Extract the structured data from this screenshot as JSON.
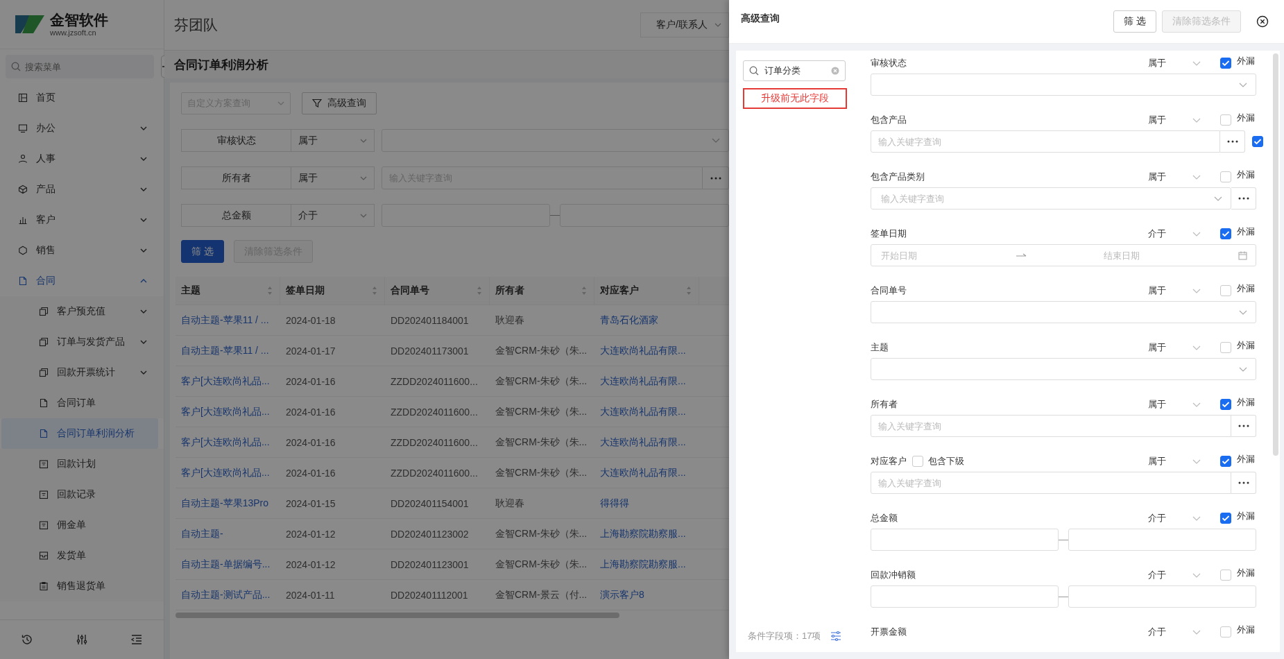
{
  "brand": {
    "name": "金智软件",
    "url": "www.jzsoft.cn"
  },
  "sidebar": {
    "search_placeholder": "搜索菜单",
    "items": [
      {
        "label": "首页",
        "selected": false
      },
      {
        "label": "办公",
        "selected": false,
        "expanded": false
      },
      {
        "label": "人事",
        "selected": false,
        "expanded": false
      },
      {
        "label": "产品",
        "selected": false,
        "expanded": false
      },
      {
        "label": "客户",
        "selected": false,
        "expanded": false
      },
      {
        "label": "销售",
        "selected": false,
        "expanded": false
      },
      {
        "label": "合同",
        "selected": true,
        "expanded": true,
        "children": [
          {
            "label": "客户预充值",
            "selected": false,
            "expanded": false
          },
          {
            "label": "订单与发货产品",
            "selected": false,
            "expanded": false
          },
          {
            "label": "回款开票统计",
            "selected": false,
            "expanded": false
          },
          {
            "label": "合同订单",
            "selected": false
          },
          {
            "label": "合同订单利润分析",
            "selected": true
          },
          {
            "label": "回款计划",
            "selected": false
          },
          {
            "label": "回款记录",
            "selected": false
          },
          {
            "label": "佣金单",
            "selected": false
          },
          {
            "label": "发货单",
            "selected": false
          },
          {
            "label": "销售退货单",
            "selected": false
          }
        ]
      }
    ]
  },
  "header": {
    "team": "芬团队",
    "dropdown": "客户/联系人"
  },
  "page": {
    "title": "合同订单利润分析",
    "scheme_placeholder": "自定义方案查询",
    "advanced_button": "高级查询",
    "filters": [
      {
        "label": "审核状态",
        "operator": "属于",
        "kind": "select"
      },
      {
        "label": "所有者",
        "operator": "属于",
        "kind": "keyword",
        "placeholder": "输入关键字查询"
      },
      {
        "label": "总金额",
        "operator": "介于",
        "kind": "range"
      }
    ],
    "buttons": [
      {
        "label": "筛 选",
        "disabled": false
      },
      {
        "label": "清除筛选条件",
        "disabled": true
      }
    ],
    "table": {
      "columns": [
        {
          "label": "主题",
          "link": true
        },
        {
          "label": "签单日期",
          "link": false
        },
        {
          "label": "合同单号",
          "link": false
        },
        {
          "label": "所有者",
          "link": false
        },
        {
          "label": "对应客户",
          "link": true
        }
      ],
      "rows": [
        [
          "自动主题-苹果11 / ...",
          "2024-01-18",
          "DD202401184001",
          "耿迎春",
          "青岛石化酒家"
        ],
        [
          "自动主题-苹果11 / ...",
          "2024-01-17",
          "DD202401173001",
          "金智CRM-朱砂（朱...",
          "大连欧尚礼品有限..."
        ],
        [
          "客户[大连欧尚礼品...",
          "2024-01-16",
          "ZZDD2024011600...",
          "金智CRM-朱砂（朱...",
          "大连欧尚礼品有限..."
        ],
        [
          "客户[大连欧尚礼品...",
          "2024-01-16",
          "ZZDD2024011600...",
          "金智CRM-朱砂（朱...",
          "大连欧尚礼品有限..."
        ],
        [
          "客户[大连欧尚礼品...",
          "2024-01-16",
          "ZZDD2024011600...",
          "金智CRM-朱砂（朱...",
          "大连欧尚礼品有限..."
        ],
        [
          "客户[大连欧尚礼品...",
          "2024-01-16",
          "ZZDD2024011600...",
          "金智CRM-朱砂（朱...",
          "大连欧尚礼品有限..."
        ],
        [
          "自动主题-苹果13Pro",
          "2024-01-15",
          "DD202401154001",
          "耿迎春",
          "得得得"
        ],
        [
          "自动主题-",
          "2024-01-12",
          "DD202401123002",
          "金智CRM-朱砂（朱...",
          "上海勘察院勘察服..."
        ],
        [
          "自动主题-单据编号...",
          "2024-01-12",
          "DD202401123001",
          "金智CRM-朱砂（朱...",
          "上海勘察院勘察服..."
        ],
        [
          "自动主题-测试产品...",
          "2024-01-11",
          "DD202401112001",
          "金智CRM-景云（付...",
          "演示客户8"
        ]
      ]
    }
  },
  "drawer": {
    "title": "高级查询",
    "buttons": [
      {
        "label": "筛 选",
        "disabled": false
      },
      {
        "label": "清除筛选条件",
        "disabled": true
      }
    ],
    "search": {
      "value": "订单分类"
    },
    "notice": "升级前无此字段",
    "count_label": "条件字段项：17项",
    "fields": [
      {
        "label": "审核状态",
        "operator": "属于",
        "leak_label": "外漏",
        "leak_checked": true,
        "kind": "select"
      },
      {
        "label": "包含产品",
        "operator": "属于",
        "leak_label": "外漏",
        "leak_checked": false,
        "kind": "keyword",
        "placeholder": "输入关键字查询",
        "extra_checked": true
      },
      {
        "label": "包含产品类别",
        "operator": "属于",
        "leak_label": "外漏",
        "leak_checked": false,
        "kind": "keyword_select",
        "placeholder": "输入关键字查询"
      },
      {
        "label": "签单日期",
        "operator": "介于",
        "leak_label": "外漏",
        "leak_checked": true,
        "kind": "daterange",
        "start_placeholder": "开始日期",
        "end_placeholder": "结束日期"
      },
      {
        "label": "合同单号",
        "operator": "属于",
        "leak_label": "外漏",
        "leak_checked": false,
        "kind": "select"
      },
      {
        "label": "主题",
        "operator": "属于",
        "leak_label": "外漏",
        "leak_checked": false,
        "kind": "select"
      },
      {
        "label": "所有者",
        "operator": "属于",
        "leak_label": "外漏",
        "leak_checked": true,
        "kind": "keyword",
        "placeholder": "输入关键字查询"
      },
      {
        "label": "对应客户",
        "operator": "属于",
        "leak_label": "外漏",
        "leak_checked": true,
        "kind": "keyword",
        "placeholder": "输入关键字查询",
        "sub_option": {
          "label": "包含下级",
          "checked": false
        }
      },
      {
        "label": "总金额",
        "operator": "介于",
        "leak_label": "外漏",
        "leak_checked": true,
        "kind": "range"
      },
      {
        "label": "回款冲销额",
        "operator": "介于",
        "leak_label": "外漏",
        "leak_checked": false,
        "kind": "range"
      },
      {
        "label": "开票金额",
        "operator": "介于",
        "leak_label": "外漏",
        "leak_checked": false
      }
    ]
  }
}
